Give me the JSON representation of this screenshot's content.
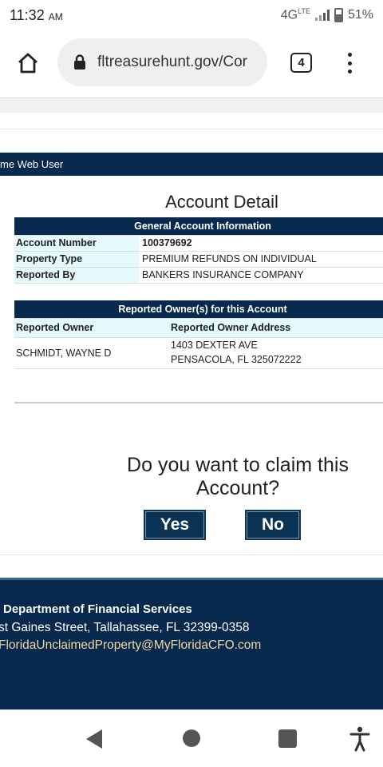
{
  "status_bar": {
    "time": "11:32",
    "ampm": "AM",
    "network": "4G",
    "network_sup": "LTE",
    "battery": "51%"
  },
  "browser": {
    "url": "fltreasurehunt.gov/Cor",
    "tab_count": "4"
  },
  "site": {
    "user_bar": "me Web User"
  },
  "account": {
    "title": "Account Detail",
    "general_header": "General Account Information",
    "rows": [
      {
        "label": "Account Number",
        "value": "100379692"
      },
      {
        "label": "Property Type",
        "value": "PREMIUM REFUNDS ON INDIVIDUAL"
      },
      {
        "label": "Reported By",
        "value": "BANKERS INSURANCE COMPANY"
      }
    ]
  },
  "owners": {
    "header": "Reported Owner(s) for this Account",
    "col_owner": "Reported Owner",
    "col_address": "Reported Owner Address",
    "owner_name": "SCHMIDT, WAYNE D",
    "address_line1": "1403 DEXTER AVE",
    "address_line2": "PENSACOLA, FL 325072222"
  },
  "claim": {
    "question": "Do you want to claim this Account?",
    "yes_label": "Yes",
    "no_label": "No"
  },
  "footer": {
    "department": "Department of Financial Services",
    "address": "st Gaines Street, Tallahassee, FL 32399-0358",
    "email": "FloridaUnclaimedProperty@MyFloridaCFO.com"
  },
  "colors": {
    "navy": "#06294d",
    "light_cyan": "#e4f9fb",
    "email_link": "#f3d9a0"
  },
  "icons": [
    "home-icon",
    "lock-icon",
    "tabs-icon",
    "overflow-menu-icon",
    "back-icon",
    "home-circle-icon",
    "recents-icon",
    "accessibility-icon",
    "signal-icon",
    "battery-icon"
  ]
}
